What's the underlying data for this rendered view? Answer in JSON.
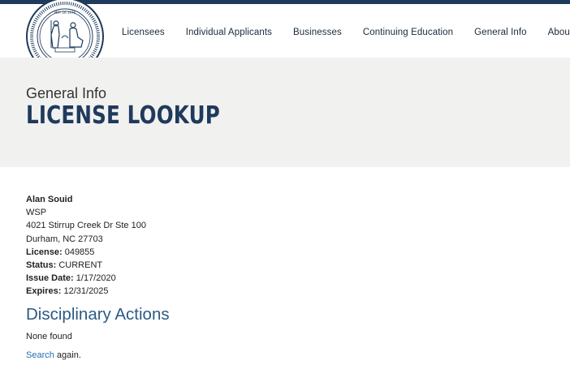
{
  "header": {
    "seal": {
      "inner_text": "MAY 26 1976",
      "ring_text": "NORTH CAROLINA BOARD OF EXAMINERS FOR ENGINEERS AND SURVEYORS",
      "year": "1921"
    },
    "nav": [
      {
        "label": "Licensees"
      },
      {
        "label": "Individual Applicants"
      },
      {
        "label": "Businesses"
      },
      {
        "label": "Continuing Education"
      },
      {
        "label": "General Info"
      },
      {
        "label": "About Us"
      }
    ]
  },
  "hero": {
    "kicker": "General Info",
    "title": "LICENSE LOOKUP"
  },
  "record": {
    "name": "Alan Souid",
    "company": "WSP",
    "address1": "4021 Stirrup Creek Dr Ste 100",
    "address2": "Durham, NC 27703",
    "license_label": "License:",
    "license": "049855",
    "status_label": "Status:",
    "status": "CURRENT",
    "issue_label": "Issue Date:",
    "issue_date": "1/17/2020",
    "expires_label": "Expires:",
    "expires": "12/31/2025"
  },
  "disciplinary": {
    "title": "Disciplinary Actions",
    "result": "None found"
  },
  "search_again": {
    "link": "Search",
    "rest": " again."
  },
  "colors": {
    "brand": "#1f3a5c",
    "link": "#1f6fb1",
    "section": "#2c5a86",
    "hero_bg": "#f1f1f0"
  }
}
